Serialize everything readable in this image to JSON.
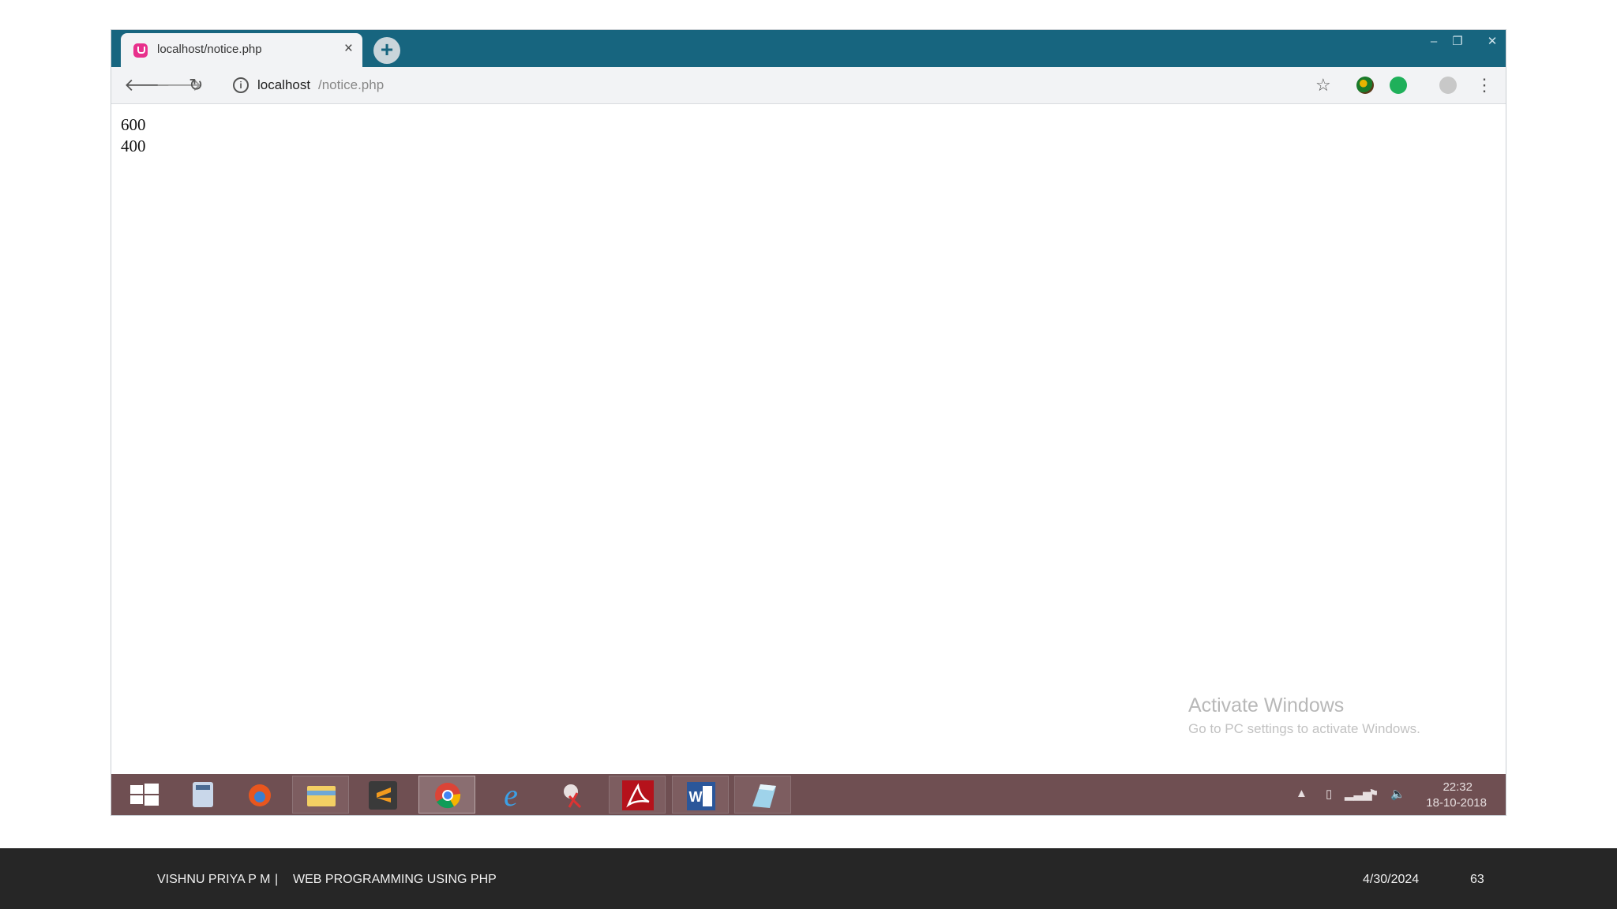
{
  "browser": {
    "tab_title": "localhost/notice.php",
    "tab_close": "×",
    "new_tab": "+",
    "url_host": "localhost",
    "url_path": "/notice.php",
    "window_controls": {
      "minimize": "–",
      "restore": "❐",
      "close": "✕"
    },
    "toolbar_icons": [
      "back-arrow-icon",
      "forward-arrow-icon",
      "reload-icon",
      "info-icon",
      "bookmark-star-icon",
      "extension-icon",
      "grammarly-icon",
      "profile-icon",
      "menu-dots-icon"
    ]
  },
  "page": {
    "lines": [
      "600",
      "400"
    ]
  },
  "watermark": {
    "title": "Activate Windows",
    "subtitle": "Go to PC settings to activate Windows."
  },
  "taskbar": {
    "apps": [
      "start",
      "calculator",
      "firefox",
      "file-explorer",
      "sublime-text",
      "chrome",
      "internet-explorer",
      "snipping-tool",
      "acrobat",
      "word",
      "notepad"
    ],
    "active_app": "chrome",
    "time": "22:32",
    "date": "18-10-2018"
  },
  "footer": {
    "author": "VISHNU PRIYA P M",
    "separator": "|",
    "course": "WEB PROGRAMMING USING PHP",
    "date": "4/30/2024",
    "page_number": "63"
  },
  "colors": {
    "titlebar": "#17657f",
    "taskbar": "#6f4f52",
    "footer": "#262626"
  }
}
